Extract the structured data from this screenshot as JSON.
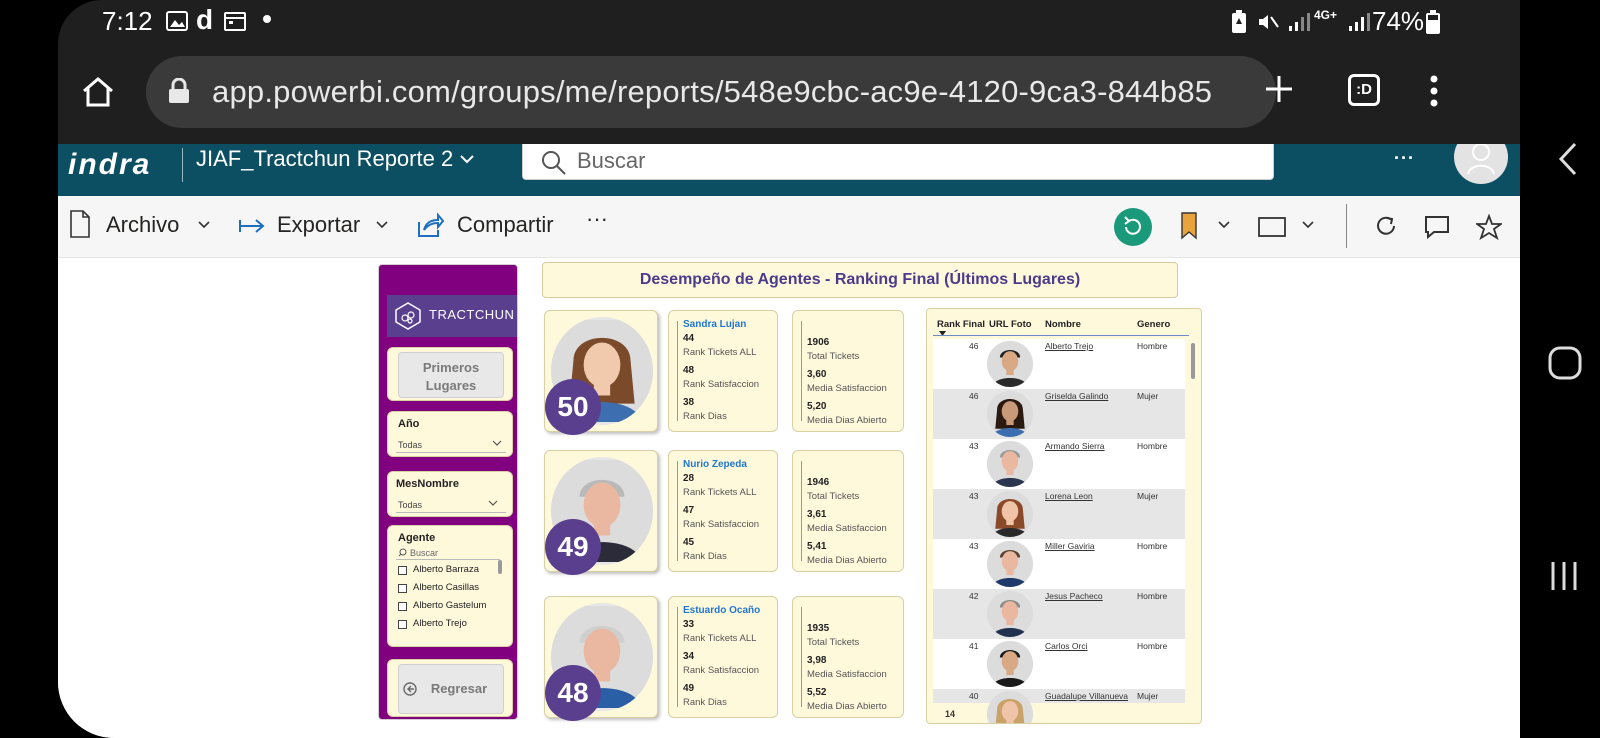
{
  "status_bar": {
    "time": "7:12",
    "battery": "74%",
    "network": "4G+"
  },
  "browser": {
    "url": "app.powerbi.com/groups/me/reports/548e9cbc-ac9e-4120-9ca3-844b85",
    "tab_badge": ":D"
  },
  "pbi": {
    "logo": "indra",
    "report_name": "JIAF_Tractchun Reporte 2",
    "search_placeholder": "Buscar",
    "menu": {
      "archivo": "Archivo",
      "exportar": "Exportar",
      "compartir": "Compartir",
      "more": "···"
    }
  },
  "report": {
    "title": "Desempeño de Agentes - Ranking Final (Últimos Lugares)",
    "brand": "TRACTCHUN",
    "primeros_btn": "Primeros Lugares",
    "regresar_btn": "Regresar",
    "slicers": {
      "anio": {
        "title": "Año",
        "value": "Todas"
      },
      "mes": {
        "title": "MesNombre",
        "value": "Todas"
      },
      "agente": {
        "title": "Agente",
        "search": "Buscar",
        "options": [
          "Alberto Barraza",
          "Alberto Casillas",
          "Alberto Gastelum",
          "Alberto Trejo"
        ]
      }
    },
    "labels": {
      "rank_tickets": "Rank Tickets ALL",
      "rank_satisfaccion": "Rank Satisfaccion",
      "rank_dias": "Rank Dias",
      "total_tickets": "Total Tickets",
      "media_satisfaccion": "Media Satisfaccion",
      "media_dias": "Media Dias Abierto"
    },
    "agents": [
      {
        "rank": "50",
        "name": "Sandra Lujan",
        "rank_tickets": "44",
        "rank_satisfaccion": "48",
        "rank_dias": "38",
        "total_tickets": "1906",
        "media_satisfaccion": "3,60",
        "media_dias": "5,20"
      },
      {
        "rank": "49",
        "name": "Nurio Zepeda",
        "rank_tickets": "28",
        "rank_satisfaccion": "47",
        "rank_dias": "45",
        "total_tickets": "1946",
        "media_satisfaccion": "3,61",
        "media_dias": "5,41"
      },
      {
        "rank": "48",
        "name": "Estuardo Ocaño",
        "rank_tickets": "33",
        "rank_satisfaccion": "34",
        "rank_dias": "49",
        "total_tickets": "1935",
        "media_satisfaccion": "3,98",
        "media_dias": "5,52"
      }
    ],
    "table": {
      "headers": [
        "Rank Final",
        "URL Foto",
        "Nombre",
        "Genero"
      ],
      "rows": [
        {
          "rank": "46",
          "name": "Alberto Trejo",
          "gender": "Hombre"
        },
        {
          "rank": "46",
          "name": "Griselda Galindo",
          "gender": "Mujer"
        },
        {
          "rank": "43",
          "name": "Armando Sierra",
          "gender": "Hombre"
        },
        {
          "rank": "43",
          "name": "Lorena Leon",
          "gender": "Mujer"
        },
        {
          "rank": "43",
          "name": "Miller Gaviria",
          "gender": "Hombre"
        },
        {
          "rank": "42",
          "name": "Jesus Pacheco",
          "gender": "Hombre"
        },
        {
          "rank": "41",
          "name": "Carlos Orci",
          "gender": "Hombre"
        },
        {
          "rank": "40",
          "name": "Guadalupe Villanueva",
          "gender": "Mujer"
        }
      ],
      "footer_rank": "14"
    }
  },
  "colors": {
    "pbi_header": "#0c4f62",
    "side_panel": "#800080",
    "card_bg": "#fff9dc",
    "badge": "#5b3f8f",
    "agent_name": "#1f77d0",
    "reset_button": "#1a9a7a",
    "bookmark": "#e8a33d"
  }
}
